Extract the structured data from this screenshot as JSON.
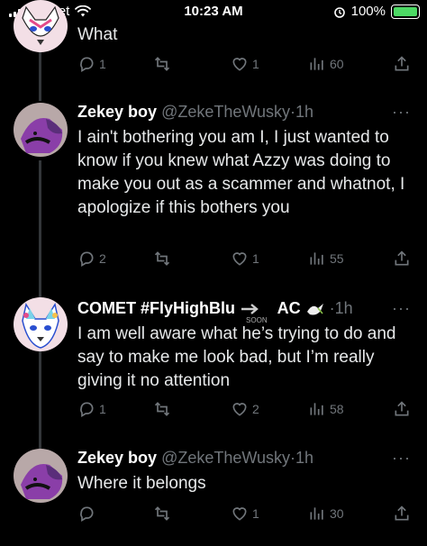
{
  "status_bar": {
    "carrier": "cricket",
    "time": "10:23 AM",
    "battery": "100%"
  },
  "tweets": [
    {
      "text": "What",
      "replies": "1",
      "likes": "1",
      "views": "60"
    },
    {
      "name": "Zekey boy",
      "handle": "@ZekeTheWusky",
      "dot": "·",
      "time": "1h",
      "text": "I ain't bothering you am I, I just wanted to know if you knew what Azzy was doing to make you out as a scammer and whatnot, I apologize if this bothers you",
      "replies": "2",
      "likes": "1",
      "views": "55"
    },
    {
      "name": "COMET #FlyHighBlu",
      "name_suffix": "AC",
      "soon_badge": "SOON",
      "dot": "·",
      "time": "1h",
      "text": "I am well aware what he’s trying to do and say to make me look bad, but I’m really giving it no attention",
      "replies": "1",
      "likes": "2",
      "views": "58"
    },
    {
      "name": "Zekey boy",
      "handle": "@ZekeTheWusky",
      "dot": "·",
      "time": "1h",
      "text": "Where it belongs",
      "replies": "",
      "likes": "1",
      "views": "30"
    }
  ],
  "more_label": "···",
  "icons": [
    "wifi-icon",
    "alarm-icon",
    "reply-icon",
    "retweet-icon",
    "like-icon",
    "views-icon",
    "share-icon",
    "arrow-right-icon",
    "dove-icon"
  ],
  "colors": {
    "background": "#000000",
    "text": "#e7e9ea",
    "muted": "#71767b",
    "battery": "#4cd964"
  }
}
